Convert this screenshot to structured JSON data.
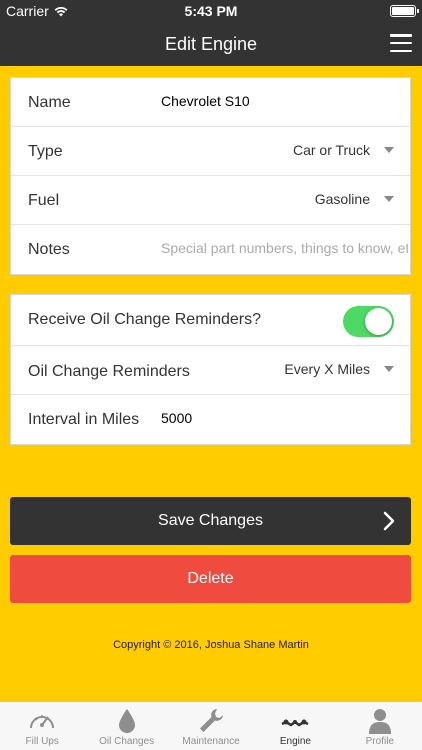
{
  "status_bar": {
    "carrier": "Carrier",
    "time": "5:43 PM"
  },
  "nav": {
    "title": "Edit Engine"
  },
  "engine_form": {
    "name_label": "Name",
    "name_value": "Chevrolet S10",
    "type_label": "Type",
    "type_value": "Car or Truck",
    "fuel_label": "Fuel",
    "fuel_value": "Gasoline",
    "notes_label": "Notes",
    "notes_placeholder": "Special part numbers, things to know, etc."
  },
  "reminder_form": {
    "receive_label": "Receive Oil Change Reminders?",
    "receive_enabled": true,
    "reminders_label": "Oil Change Reminders",
    "reminders_value": "Every X Miles",
    "interval_label": "Interval in Miles",
    "interval_value": "5000"
  },
  "actions": {
    "save_label": "Save Changes",
    "delete_label": "Delete"
  },
  "footer": {
    "copyright": "Copyright © 2016, Joshua Shane Martin"
  },
  "tabs": [
    {
      "label": "Fill Ups",
      "icon": "gauge-icon",
      "active": false
    },
    {
      "label": "Oil Changes",
      "icon": "oil-drop-icon",
      "active": false
    },
    {
      "label": "Maintenance",
      "icon": "wrench-icon",
      "active": false
    },
    {
      "label": "Engine",
      "icon": "engine-icon",
      "active": true
    },
    {
      "label": "Profile",
      "icon": "person-icon",
      "active": false
    }
  ],
  "colors": {
    "background": "#ffcc00",
    "bar": "#333333",
    "toggle_on": "#4cd964",
    "delete": "#ef4b3f"
  }
}
